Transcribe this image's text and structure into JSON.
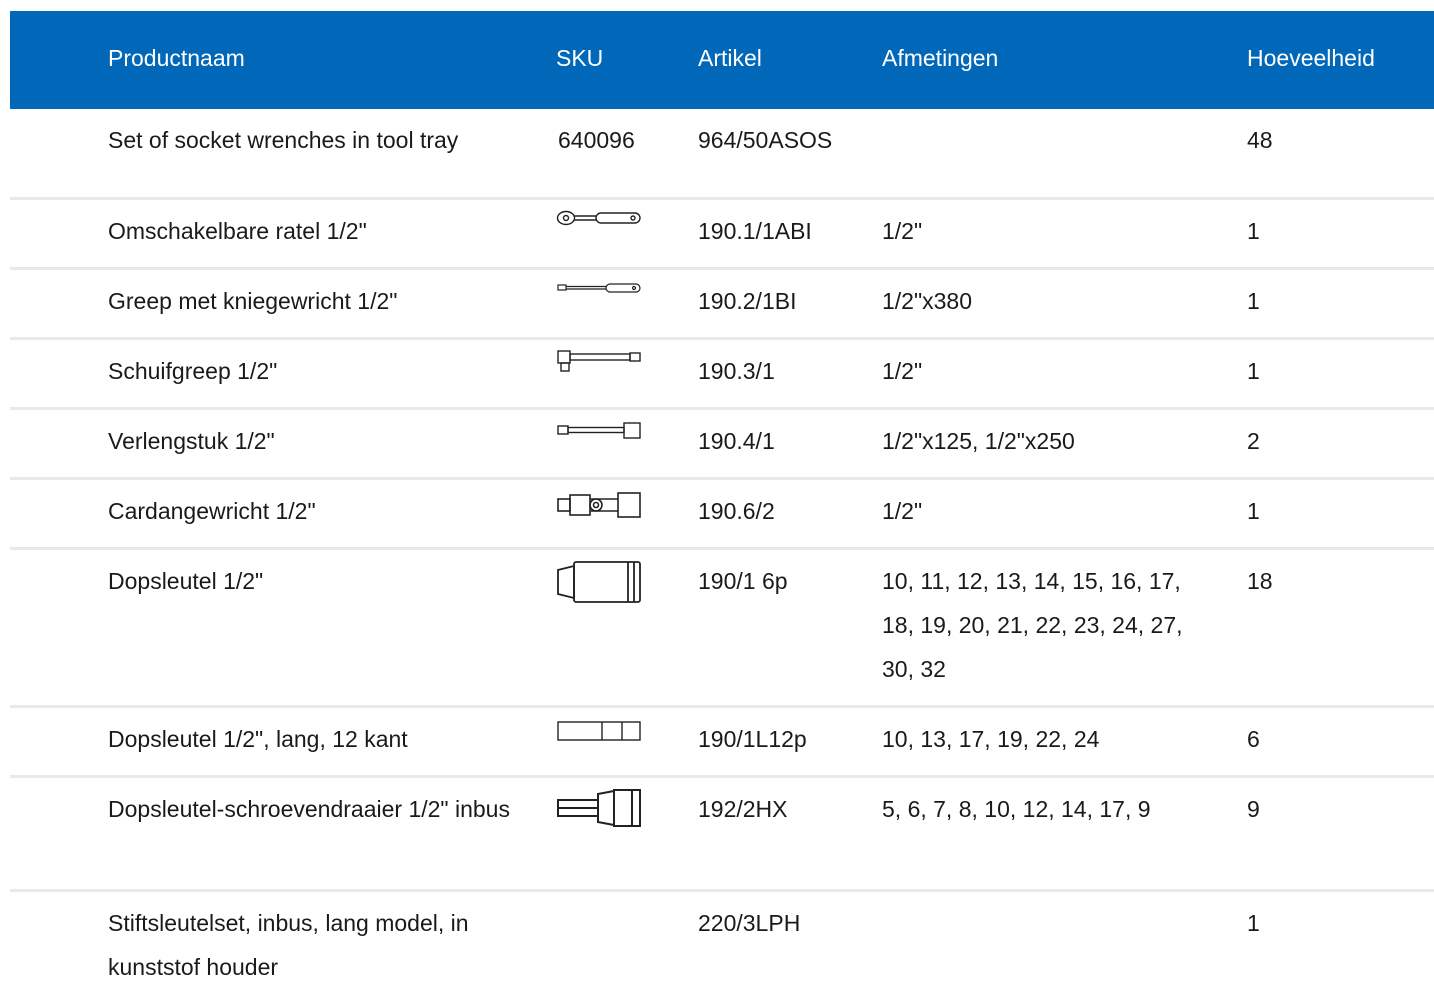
{
  "header": {
    "product_name": "Productnaam",
    "sku": "SKU",
    "article": "Artikel",
    "dimensions": "Afmetingen",
    "quantity": "Hoeveelheid"
  },
  "colors": {
    "header_bg": "#0067b9",
    "header_text": "#ffffff",
    "divider": "#e9e9e9"
  },
  "rows": [
    {
      "name": "Set of socket wrenches in tool tray",
      "sku": "640096",
      "icon": null,
      "article": "964/50ASOS",
      "dimensions": "",
      "quantity": "48"
    },
    {
      "name": "Omschakelbare ratel 1/2\"",
      "sku": "",
      "icon": "ratchet-icon",
      "article": "190.1/1ABI",
      "dimensions": "1/2\"",
      "quantity": "1"
    },
    {
      "name": "Greep met kniegewricht 1/2\"",
      "sku": "",
      "icon": "breaker-bar-icon",
      "article": "190.2/1BI",
      "dimensions": "1/2\"x380",
      "quantity": "1"
    },
    {
      "name": "Schuifgreep 1/2\"",
      "sku": "",
      "icon": "sliding-t-handle-icon",
      "article": "190.3/1",
      "dimensions": "1/2\"",
      "quantity": "1"
    },
    {
      "name": "Verlengstuk 1/2\"",
      "sku": "",
      "icon": "extension-bar-icon",
      "article": "190.4/1",
      "dimensions": "1/2\"x125, 1/2\"x250",
      "quantity": "2"
    },
    {
      "name": "Cardangewricht 1/2\"",
      "sku": "",
      "icon": "universal-joint-icon",
      "article": "190.6/2",
      "dimensions": "1/2\"",
      "quantity": "1"
    },
    {
      "name": "Dopsleutel 1/2\"",
      "sku": "",
      "icon": "socket-icon",
      "article": "190/1 6p",
      "dimensions": "10, 11, 12, 13, 14, 15, 16, 17, 18, 19, 20, 21, 22, 23, 24, 27, 30, 32",
      "quantity": "18"
    },
    {
      "name": "Dopsleutel 1/2\", lang, 12 kant",
      "sku": "",
      "icon": "long-socket-icon",
      "article": "190/1L12p",
      "dimensions": "10, 13, 17, 19, 22, 24",
      "quantity": "6"
    },
    {
      "name": "Dopsleutel-schroevendraaier 1/2\" inbus",
      "sku": "",
      "icon": "hex-bit-socket-icon",
      "article": "192/2HX",
      "dimensions": "5, 6, 7, 8, 10, 12, 14, 17, 9",
      "quantity": "9"
    },
    {
      "name": "Stiftsleutelset, inbus, lang model, in kunststof houder",
      "sku": "",
      "icon": null,
      "article": "220/3LPH",
      "dimensions": "",
      "quantity": "1"
    }
  ]
}
